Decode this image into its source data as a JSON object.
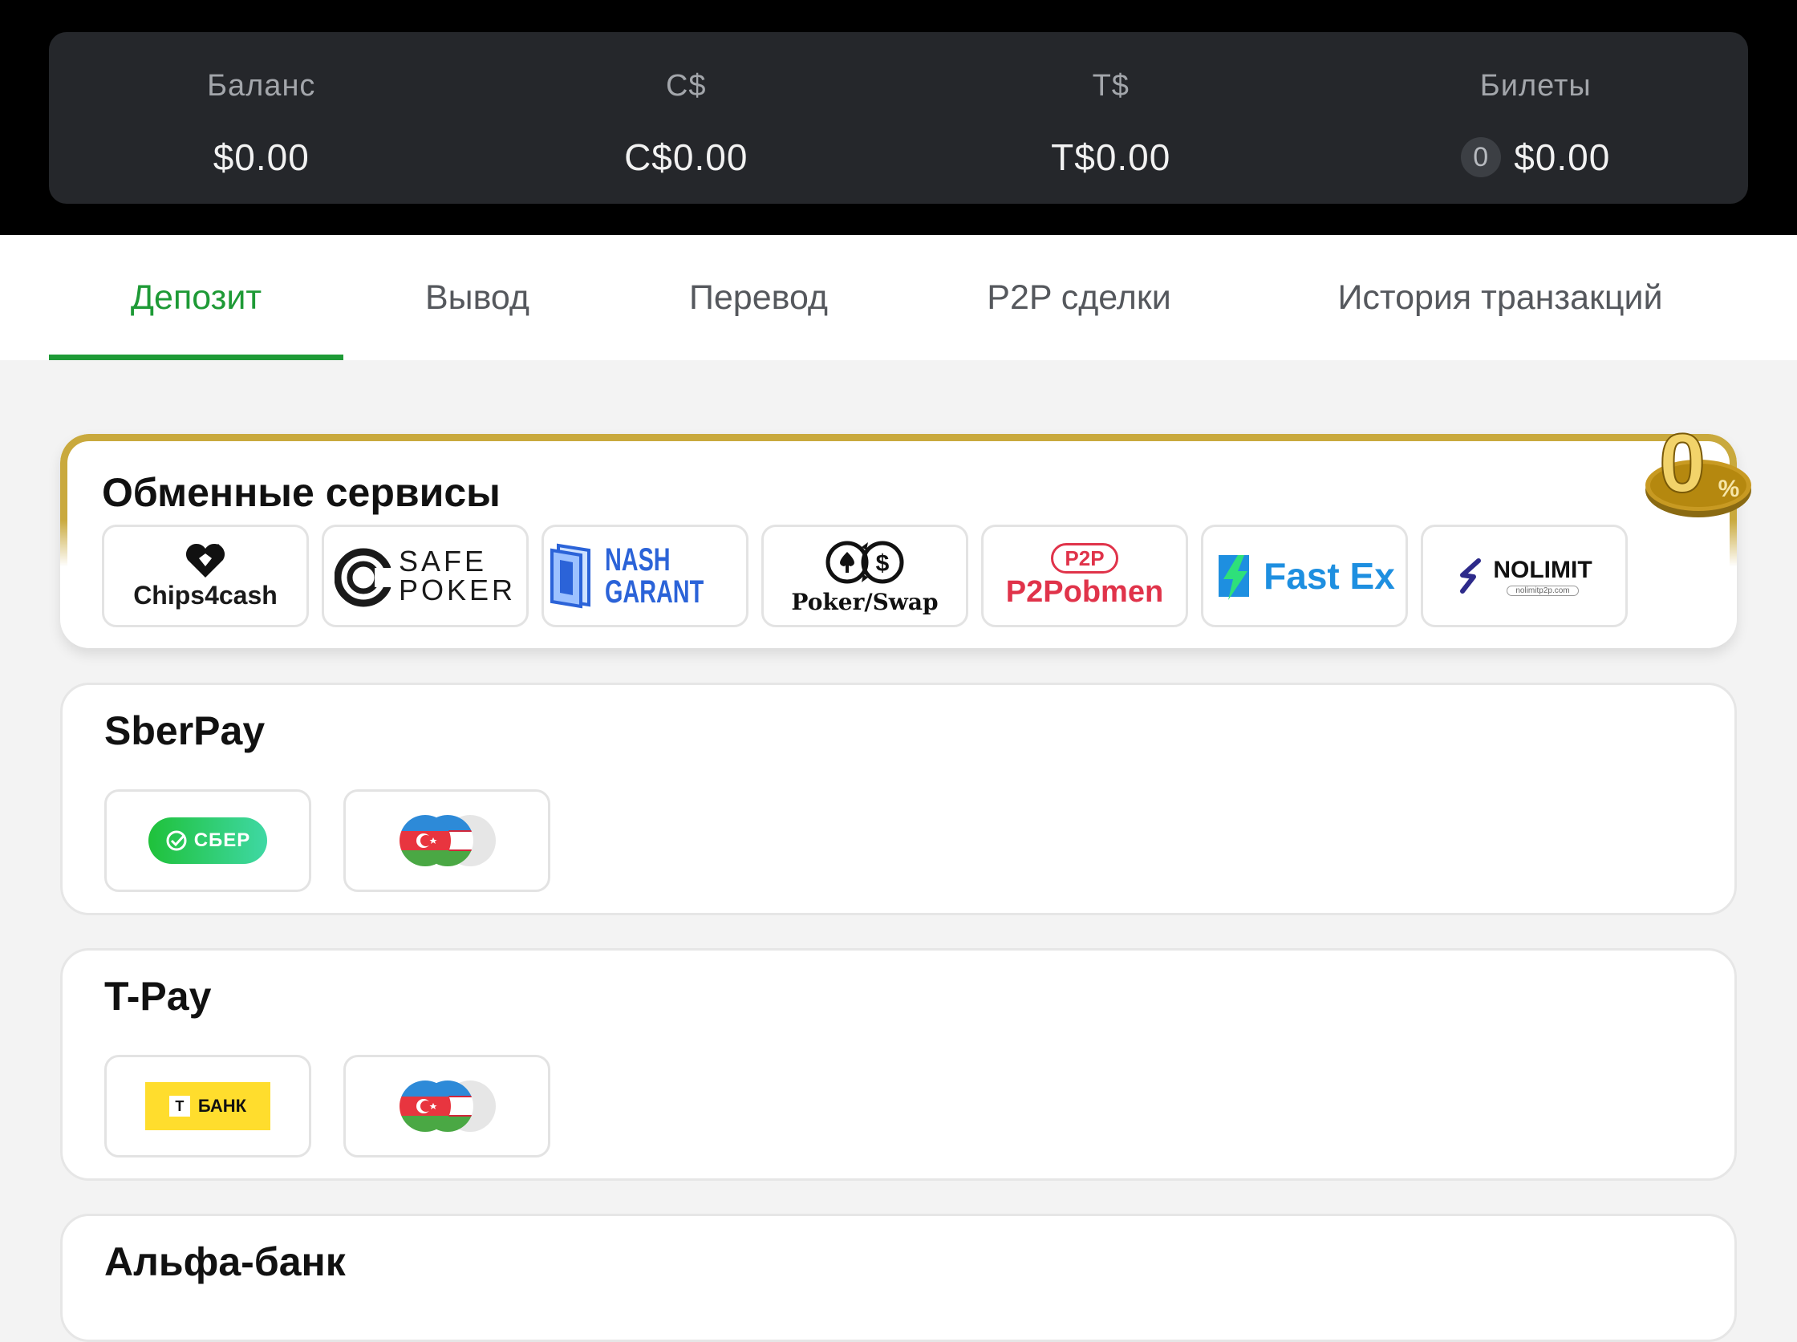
{
  "balances": [
    {
      "label": "Баланс",
      "value": "$0.00"
    },
    {
      "label": "C$",
      "value": "C$0.00"
    },
    {
      "label": "T$",
      "value": "T$0.00"
    },
    {
      "label": "Билеты",
      "count": "0",
      "value": "$0.00"
    }
  ],
  "tabs": [
    "Депозит",
    "Вывод",
    "Перевод",
    "P2P сделки",
    "История транзакций"
  ],
  "active_tab": "Депозит",
  "exchange": {
    "title": "Обменные сервисы",
    "badge": {
      "big": "0",
      "small": "%"
    },
    "services": [
      {
        "name": "Chips4cash",
        "icon": "heart-chip-icon"
      },
      {
        "name": "SAFE POKER",
        "top": "SAFE",
        "bottom": "POKER",
        "icon": "safe-poker-icon"
      },
      {
        "name": "NASH GARANT",
        "top": "NASH",
        "bottom": "GARANT",
        "icon": "nash-garant-icon"
      },
      {
        "name": "Poker/Swap",
        "icon": "poker-swap-icon"
      },
      {
        "name": "P2Pobmen",
        "badge": "P2P",
        "icon": "p2p-icon"
      },
      {
        "name": "Fast Ex",
        "icon": "lightning-icon"
      },
      {
        "name": "NOLIMIT",
        "sub": "nolimitp2p.com",
        "icon": "nolimit-icon"
      }
    ]
  },
  "sberpay": {
    "title": "SberPay",
    "bank_label": "СБЕР"
  },
  "tpay": {
    "title": "T-Pay",
    "bank_label": "БАНК",
    "bank_letter": "Т"
  },
  "alfa": {
    "title": "Альфа-банк"
  },
  "colors": {
    "accent": "#1e9a36",
    "gold": "#c9a93d",
    "header_bg": "#000000",
    "card_bg": "#25272b"
  }
}
